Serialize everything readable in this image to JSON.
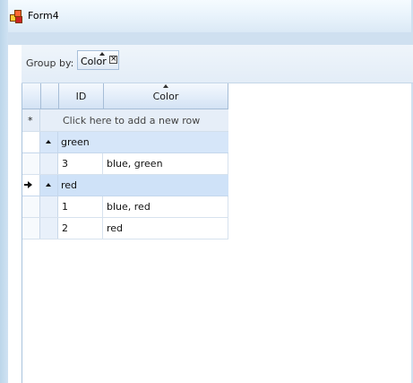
{
  "window": {
    "title": "Form4"
  },
  "group_panel": {
    "label": "Group by:",
    "chip": {
      "label": "Color",
      "close_glyph": "×"
    }
  },
  "grid": {
    "columns": [
      {
        "label": "ID"
      },
      {
        "label": "Color",
        "sorted": "ascending"
      }
    ],
    "new_row": {
      "marker": "*",
      "label": "Click here to add a new row"
    },
    "groups": [
      {
        "name": "green",
        "expanded": true,
        "rows": [
          {
            "id": "3",
            "color": "blue, green"
          }
        ]
      },
      {
        "name": "red",
        "expanded": true,
        "current": true,
        "rows": [
          {
            "id": "1",
            "color": "blue, red"
          },
          {
            "id": "2",
            "color": "red"
          }
        ]
      }
    ]
  }
}
